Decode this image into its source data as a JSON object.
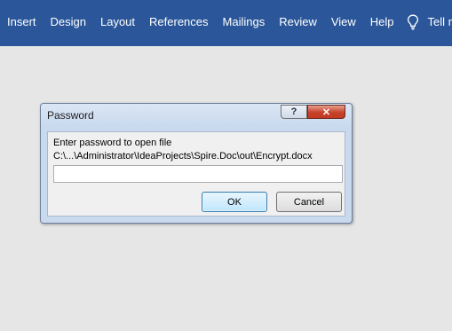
{
  "ribbon": {
    "tabs": [
      "Insert",
      "Design",
      "Layout",
      "References",
      "Mailings",
      "Review",
      "View",
      "Help"
    ],
    "tell_me": "Tell me"
  },
  "dialog": {
    "title": "Password",
    "help_label": "?",
    "close_label": "✕",
    "prompt": "Enter password to open file",
    "file_path": "C:\\...\\Administrator\\IdeaProjects\\Spire.Doc\\out\\Encrypt.docx",
    "password_value": "",
    "ok_label": "OK",
    "cancel_label": "Cancel"
  },
  "colors": {
    "ribbon": "#2b579a",
    "workspace": "#e6e6e6",
    "close_button": "#c6412a"
  }
}
